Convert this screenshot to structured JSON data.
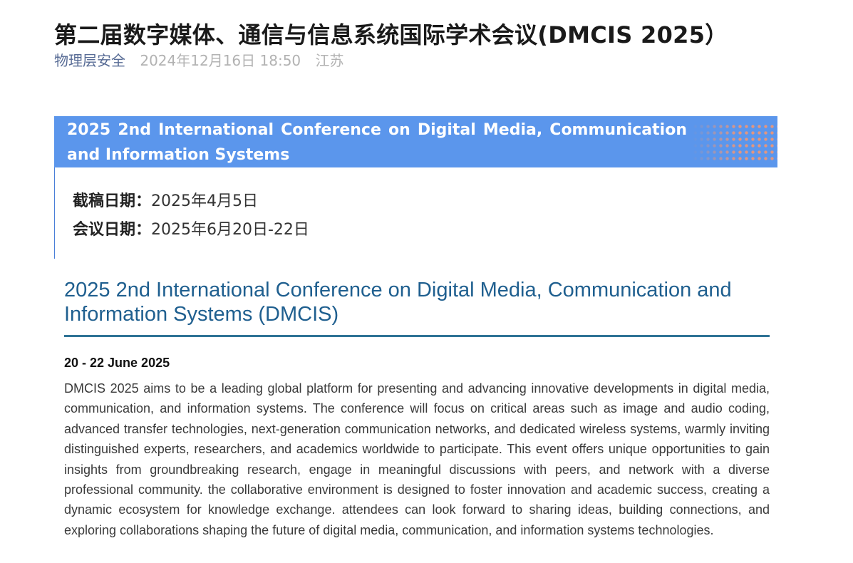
{
  "article": {
    "title": "第二届数字媒体、通信与信息系统国际学术会议(DMCIS 2025）",
    "account": "物理层安全",
    "publish_time": "2024年12月16日 18:50",
    "location": "江苏"
  },
  "card": {
    "banner": "2025 2nd International Conference on Digital Media, Communication and Information Systems",
    "deadline_label": "截稿日期：",
    "deadline_value": "2025年4月5日",
    "conf_date_label": "会议日期：",
    "conf_date_value": "2025年6月20日-22日"
  },
  "poster": {
    "title": "2025 2nd International Conference on Digital Media, Communication and Information Systems (DMCIS)",
    "dates": "20 - 22 June 2025",
    "body": "DMCIS 2025 aims to be a leading global platform for presenting and advancing innovative developments in digital media, communication, and information systems. The conference will focus on critical areas such as image and audio coding, advanced transfer technologies, next-generation communication networks, and dedicated wireless systems, warmly inviting distinguished experts, researchers, and academics worldwide to participate. This event offers unique opportunities to gain insights from groundbreaking research, engage in meaningful discussions with peers, and network with a diverse professional community. the collaborative environment is designed to foster innovation and academic success, creating a dynamic ecosystem for knowledge exchange. attendees can look forward to sharing ideas, building connections, and exploring collaborations shaping the future of digital media, communication, and information systems technologies."
  },
  "colors": {
    "banner_bg": "#5b96ec",
    "account_link": "#576b95",
    "poster_title": "#1f5f8f"
  }
}
